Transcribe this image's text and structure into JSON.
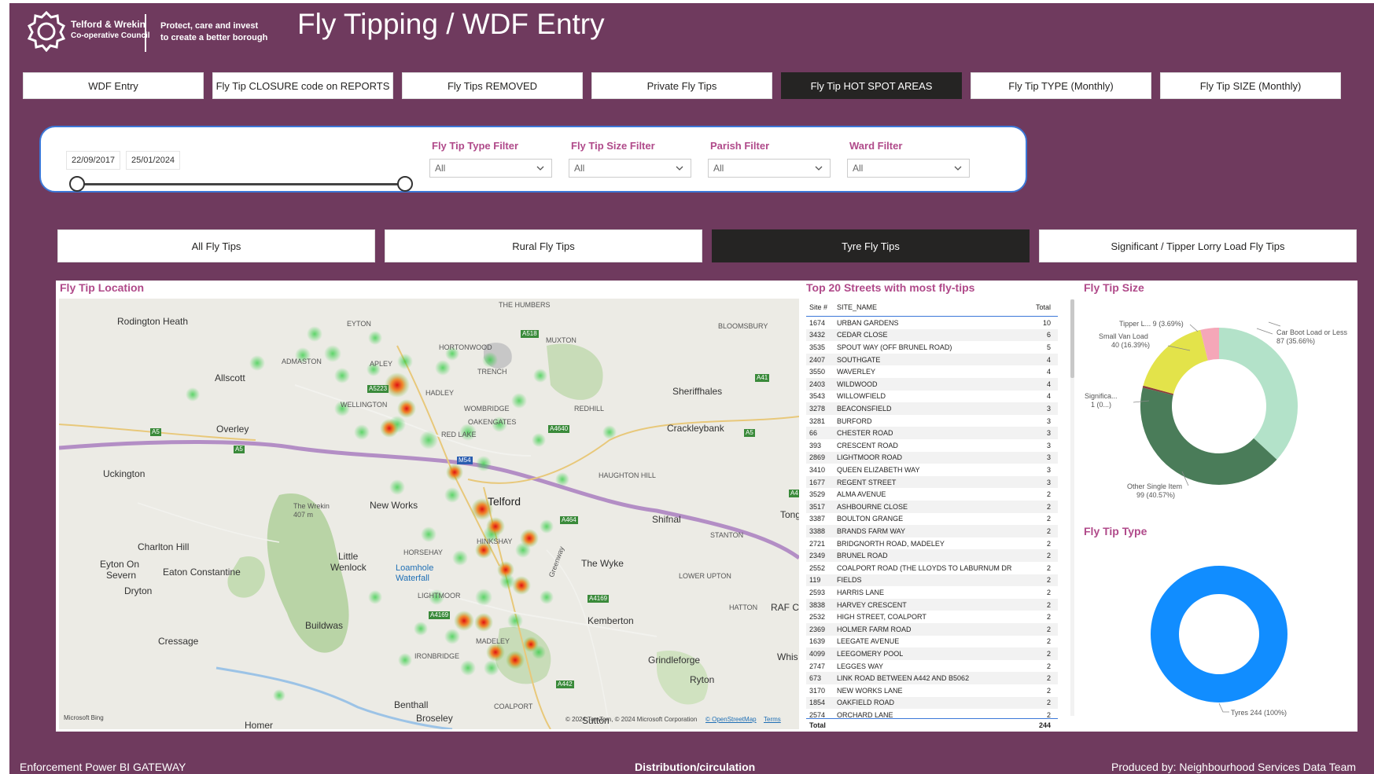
{
  "header": {
    "org_line1": "Telford & Wrekin",
    "org_line2": "Co-operative Council",
    "tagline_line1": "Protect, care and invest",
    "tagline_line2": "to create a better borough",
    "title": "Fly Tipping / WDF Entry"
  },
  "nav": {
    "tabs": [
      {
        "label": "WDF Entry",
        "active": false
      },
      {
        "label": "Fly Tip CLOSURE code on REPORTS",
        "active": false
      },
      {
        "label": "Fly Tips REMOVED",
        "active": false
      },
      {
        "label": "Private Fly Tips",
        "active": false
      },
      {
        "label": "Fly Tip HOT SPOT AREAS",
        "active": true
      },
      {
        "label": "Fly Tip TYPE (Monthly)",
        "active": false
      },
      {
        "label": "Fly Tip SIZE (Monthly)",
        "active": false
      }
    ]
  },
  "filters": {
    "date_start": "22/09/2017",
    "date_end": "25/01/2024",
    "type_label": "Fly Tip Type Filter",
    "type_value": "All",
    "size_label": "Fly Tip Size Filter",
    "size_value": "All",
    "parish_label": "Parish Filter",
    "parish_value": "All",
    "ward_label": "Ward Filter",
    "ward_value": "All"
  },
  "categories": [
    {
      "label": "All Fly Tips",
      "active": false
    },
    {
      "label": "Rural Fly Tips",
      "active": false
    },
    {
      "label": "Tyre Fly Tips",
      "active": true
    },
    {
      "label": "Significant / Tipper Lorry Load Fly Tips",
      "active": false
    }
  ],
  "map": {
    "title": "Fly Tip Location",
    "attribution": "© 2024 TomTom, © 2024 Microsoft Corporation",
    "osm": "© OpenStreetMap",
    "terms": "Terms",
    "bing": "Microsoft Bing",
    "places": {
      "rodington": "Rodington Heath",
      "eyton": "EYTON",
      "humbers": "THE HUMBERS",
      "bloomsbury": "BLOOMSBURY",
      "muxton": "MUXTON",
      "hortonwood": "HORTONWOOD",
      "admaston": "ADMASTON",
      "apley": "APLEY",
      "trench": "TRENCH",
      "allscott": "Allscott",
      "sheriffhales": "Sheriffhales",
      "hadley": "HADLEY",
      "wellington": "WELLINGTON",
      "wombridge": "WOMBRIDGE",
      "redhill": "REDHILL",
      "overley": "Overley",
      "oakengates": "OAKENGATES",
      "crackleybank": "Crackleybank",
      "redlake": "RED LAKE",
      "uckington": "Uckington",
      "haughton": "HAUGHTON HILL",
      "telford": "Telford",
      "wrekin": "The Wrekin",
      "wrekin_h": "407 m",
      "newworks": "New Works",
      "shifnal": "Shifnal",
      "stanton": "STANTON",
      "tong": "Tong",
      "charlton": "Charlton Hill",
      "hinkshay": "HINKSHAY",
      "horsehay": "HORSEHAY",
      "wenlock1": "Little",
      "wenlock2": "Wenlock",
      "wyke": "The Wyke",
      "eyton_sev1": "Eyton On",
      "eyton_sev2": "Severn",
      "eaton": "Eaton Constantine",
      "loamhole1": "Loamhole",
      "loamhole2": "Waterfall",
      "lowerupton": "LOWER UPTON",
      "dryton": "Dryton",
      "lightmoor": "LIGHTMOOR",
      "hatton": "HATTON",
      "rafcos": "RAF Co",
      "buildwas": "Buildwas",
      "kemberton": "Kemberton",
      "cressage": "Cressage",
      "madeley": "MADELEY",
      "ironbridge": "IRONBRIDGE",
      "grindleforge": "Grindleforge",
      "whis": "Whis",
      "ryton": "Ryton",
      "benthall": "Benthall",
      "coalport": "COALPORT",
      "broseley": "Broseley",
      "sutton": "Sutton",
      "homer": "Homer",
      "greenway": "Greenway"
    },
    "roads": {
      "a518": "A518",
      "a5223": "A5223",
      "a441": "A41",
      "a5a": "A5",
      "a5b": "A5",
      "a5c": "A5",
      "a4640": "A4640",
      "m54": "M54",
      "a464": "A464",
      "a4169a": "A4169",
      "a4169b": "A4169",
      "a442": "A442",
      "a4x": "A4"
    }
  },
  "table": {
    "title": "Top 20 Streets with most fly-tips",
    "col_site": "Site #",
    "col_name": "SITE_NAME",
    "col_total": "Total",
    "rows": [
      [
        "1674",
        "URBAN GARDENS",
        "10"
      ],
      [
        "3432",
        "CEDAR CLOSE",
        "6"
      ],
      [
        "3535",
        "SPOUT WAY (OFF BRUNEL ROAD)",
        "5"
      ],
      [
        "2407",
        "SOUTHGATE",
        "4"
      ],
      [
        "3550",
        "WAVERLEY",
        "4"
      ],
      [
        "2403",
        "WILDWOOD",
        "4"
      ],
      [
        "3543",
        "WILLOWFIELD",
        "4"
      ],
      [
        "3278",
        "BEACONSFIELD",
        "3"
      ],
      [
        "3281",
        "BURFORD",
        "3"
      ],
      [
        "66",
        "CHESTER ROAD",
        "3"
      ],
      [
        "393",
        "CRESCENT ROAD",
        "3"
      ],
      [
        "2869",
        "LIGHTMOOR ROAD",
        "3"
      ],
      [
        "3410",
        "QUEEN ELIZABETH WAY",
        "3"
      ],
      [
        "1677",
        "REGENT STREET",
        "3"
      ],
      [
        "3529",
        "ALMA AVENUE",
        "2"
      ],
      [
        "3517",
        "ASHBOURNE CLOSE",
        "2"
      ],
      [
        "3387",
        "BOULTON GRANGE",
        "2"
      ],
      [
        "3388",
        "BRANDS FARM WAY",
        "2"
      ],
      [
        "2721",
        "BRIDGNORTH ROAD, MADELEY",
        "2"
      ],
      [
        "2349",
        "BRUNEL ROAD",
        "2"
      ],
      [
        "2552",
        "COALPORT ROAD (THE LLOYDS TO LABURNUM DR",
        "2"
      ],
      [
        "119",
        "FIELDS",
        "2"
      ],
      [
        "2593",
        "HARRIS LANE",
        "2"
      ],
      [
        "3838",
        "HARVEY CRESCENT",
        "2"
      ],
      [
        "2532",
        "HIGH STREET, COALPORT",
        "2"
      ],
      [
        "2369",
        "HOLMER FARM ROAD",
        "2"
      ],
      [
        "1639",
        "LEEGATE AVENUE",
        "2"
      ],
      [
        "4099",
        "LEEGOMERY POOL",
        "2"
      ],
      [
        "2747",
        "LEGGES WAY",
        "2"
      ],
      [
        "673",
        "LINK ROAD BETWEEN A442 AND B5062",
        "2"
      ],
      [
        "3170",
        "NEW WORKS LANE",
        "2"
      ],
      [
        "1854",
        "OAKFIELD ROAD",
        "2"
      ],
      [
        "2574",
        "ORCHARD LANE",
        "2"
      ]
    ],
    "total_label": "Total",
    "total_value": "244"
  },
  "chart_data": [
    {
      "type": "pie",
      "title": "Fly Tip Size",
      "categories": [
        "Car Boot Load or Less",
        "Other Single Item",
        "Significa...",
        "Small Van Load",
        "Tipper L..."
      ],
      "values": [
        87,
        99,
        1,
        40,
        9
      ],
      "colors": [
        "#b3e2c9",
        "#4a7c59",
        "#8b3a3a",
        "#e3e34a",
        "#f5a7b8"
      ],
      "labels": [
        "Car Boot Load or Less",
        "87 (35.66%)",
        "Other Single Item",
        "99 (40.57%)",
        "Significa...",
        "1 (0...)",
        "Small Van Load",
        "40 (16.39%)",
        "Tipper L... 9 (3.69%)"
      ]
    },
    {
      "type": "pie",
      "title": "Fly Tip Type",
      "categories": [
        "Tyres"
      ],
      "values": [
        244
      ],
      "colors": [
        "#118dff"
      ],
      "labels": [
        "Tyres 244 (100%)"
      ]
    }
  ],
  "footer": {
    "left": "Enforcement Power BI GATEWAY",
    "center": "Distribution/circulation",
    "right": "Produced by: Neighbourhood Services Data Team"
  },
  "colors": {
    "background": "#6f3a5e",
    "accent": "#b04a8a",
    "active_button": "#252423",
    "border_blue": "#3c78d8"
  },
  "icons": {
    "logo": "council-emblem-icon",
    "chevron": "chevron-down-icon"
  }
}
